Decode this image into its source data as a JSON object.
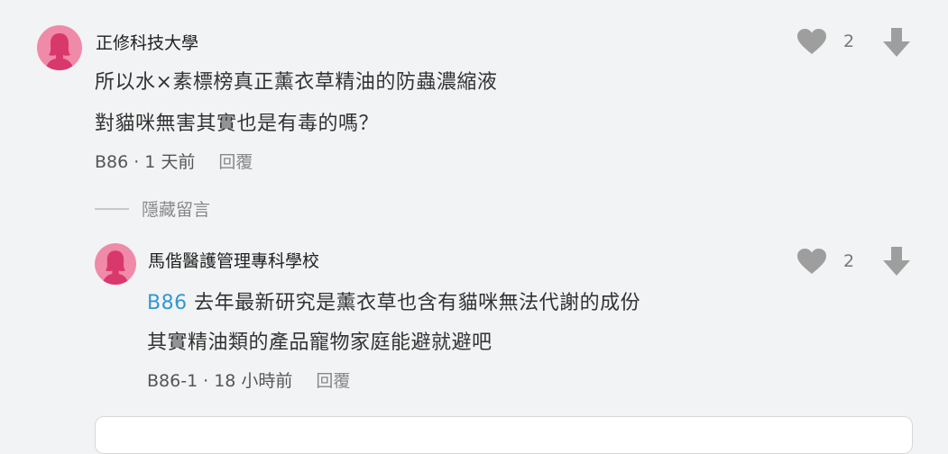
{
  "comments": [
    {
      "author": "正修科技大學",
      "lines": [
        "所以水×素標榜真正薰衣草精油的防蟲濃縮液",
        "對貓咪無害其實也是有毒的嗎？"
      ],
      "floor": "B86",
      "time": "1 天前",
      "reply_label": "回覆",
      "likes": "2"
    }
  ],
  "hide_label": "隱藏留言",
  "replies": [
    {
      "author": "馬偕醫護管理專科學校",
      "mention": "B86",
      "line1": "去年最新研究是薰衣草也含有貓咪無法代謝的成份",
      "line2": "其實精油類的產品寵物家庭能避就避吧",
      "floor": "B86-1",
      "time": "18 小時前",
      "reply_label": "回覆",
      "likes": "2"
    }
  ],
  "icons": {
    "like": "heart-icon",
    "dislike": "arrow-down-icon",
    "avatar": "female-silhouette-icon"
  },
  "colors": {
    "avatar_bg": "#f08aa9",
    "avatar_fg": "#d9386c",
    "mention": "#3397cf",
    "icon": "#9e9e9e"
  }
}
